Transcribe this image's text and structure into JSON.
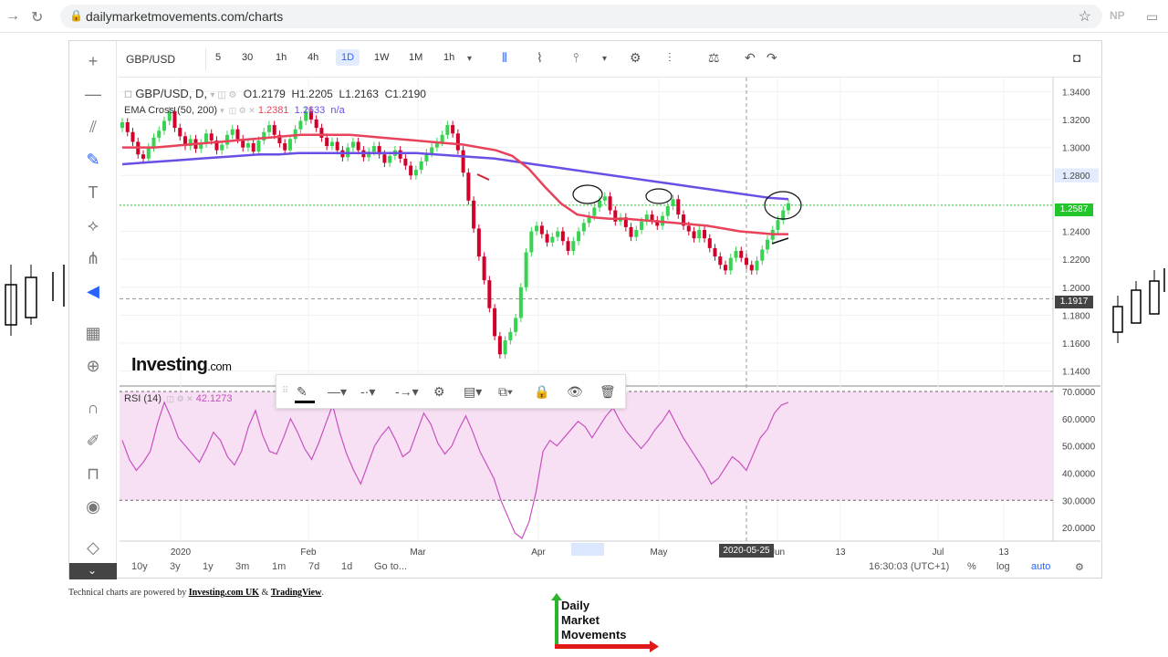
{
  "browser": {
    "url": "dailymarketmovements.com/charts",
    "profile": "NP"
  },
  "toolbar": {
    "symbol": "GBP/USD",
    "intervals": [
      "5",
      "30",
      "1h",
      "4h",
      "1D",
      "1W",
      "1M",
      "1h"
    ],
    "active_interval": "1D"
  },
  "legend": {
    "symbol_line": "GBP/USD, D,",
    "open": "O1.2179",
    "high": "H1.2205",
    "low": "L1.2163",
    "close": "C1.2190",
    "indicator_name": "EMA Cross (50, 200)",
    "ema50": "1.2381",
    "ema200": "1.2633",
    "na": "n/a",
    "rsi_name": "RSI (14)",
    "rsi_value": "42.1273"
  },
  "watermark": {
    "brand": "Investing",
    "suffix": ".com"
  },
  "price_labels": {
    "current": "1.2587",
    "crosshair": "1.1917"
  },
  "bottom_bar": {
    "ranges": [
      "10y",
      "3y",
      "1y",
      "3m",
      "1m",
      "7d",
      "1d"
    ],
    "goto": "Go to...",
    "time": "16:30:03 (UTC+1)",
    "pct": "%",
    "log": "log",
    "auto": "auto",
    "crosshair_date": "2020-05-25"
  },
  "footer": {
    "prefix": "Technical charts are powered by",
    "link1": "Investing.com UK",
    "amp": "&",
    "link2": "TradingView",
    "suffix": "."
  },
  "logo": {
    "line1": "Daily",
    "line2": "Market",
    "line3": "Movements"
  },
  "colors": {
    "bull": "#26a69a",
    "bear": "#ef5350",
    "ema50": "#e8435a",
    "ema200": "#6b4ee6",
    "rsi": "#c850c0",
    "accent": "#2962ff",
    "price_tag": "#22c52a"
  },
  "chart_data": {
    "type": "candlestick",
    "x_tick_labels": [
      "2020",
      "Feb",
      "Mar",
      "Apr",
      "May",
      "Jun",
      "13",
      "Jul",
      "13"
    ],
    "y_tick_labels": [
      "1.3400",
      "1.3200",
      "1.3000",
      "1.2800",
      "1.2400",
      "1.2200",
      "1.2000",
      "1.1800",
      "1.1600",
      "1.1400"
    ],
    "ylim": [
      1.13,
      1.35
    ],
    "rsi_tick_labels": [
      "70.0000",
      "60.0000",
      "50.0000",
      "40.0000",
      "30.0000",
      "20.0000"
    ],
    "rsi_ylim": [
      15,
      72
    ],
    "rsi_levels": [
      70,
      30
    ],
    "close": [
      1.318,
      1.311,
      1.304,
      1.295,
      1.292,
      1.3,
      1.307,
      1.312,
      1.319,
      1.326,
      1.314,
      1.308,
      1.301,
      1.306,
      1.299,
      1.303,
      1.31,
      1.305,
      1.298,
      1.302,
      1.309,
      1.313,
      1.306,
      1.3,
      1.303,
      1.297,
      1.305,
      1.311,
      1.316,
      1.309,
      1.303,
      1.298,
      1.306,
      1.313,
      1.319,
      1.326,
      1.32,
      1.314,
      1.307,
      1.301,
      1.304,
      1.298,
      1.293,
      1.3,
      1.304,
      1.298,
      1.293,
      1.297,
      1.301,
      1.295,
      1.289,
      1.294,
      1.298,
      1.292,
      1.287,
      1.28,
      1.284,
      1.29,
      1.296,
      1.3,
      1.304,
      1.309,
      1.316,
      1.31,
      1.298,
      1.282,
      1.262,
      1.242,
      1.222,
      1.205,
      1.185,
      1.165,
      1.152,
      1.162,
      1.168,
      1.178,
      1.2,
      1.225,
      1.24,
      1.244,
      1.238,
      1.232,
      1.236,
      1.24,
      1.233,
      1.226,
      1.233,
      1.24,
      1.246,
      1.251,
      1.257,
      1.262,
      1.265,
      1.255,
      1.247,
      1.25,
      1.243,
      1.236,
      1.241,
      1.247,
      1.252,
      1.248,
      1.244,
      1.251,
      1.258,
      1.263,
      1.252,
      1.244,
      1.24,
      1.235,
      1.241,
      1.235,
      1.228,
      1.222,
      1.216,
      1.212,
      1.221,
      1.226,
      1.221,
      1.216,
      1.212,
      1.219,
      1.227,
      1.234,
      1.241,
      1.248,
      1.255,
      1.26
    ],
    "ema50": [
      1.3,
      1.3,
      1.3,
      1.301,
      1.302,
      1.303,
      1.304,
      1.305,
      1.306,
      1.307,
      1.308,
      1.309,
      1.309,
      1.309,
      1.309,
      1.308,
      1.307,
      1.306,
      1.305,
      1.304,
      1.303,
      1.302,
      1.3,
      1.298,
      1.294,
      1.285,
      1.272,
      1.26,
      1.252,
      1.25,
      1.249,
      1.249,
      1.248,
      1.247,
      1.246,
      1.245,
      1.244,
      1.242,
      1.24,
      1.239,
      1.238,
      1.238
    ],
    "ema200": [
      1.288,
      1.289,
      1.29,
      1.291,
      1.292,
      1.293,
      1.294,
      1.295,
      1.295,
      1.296,
      1.296,
      1.296,
      1.296,
      1.296,
      1.296,
      1.296,
      1.295,
      1.294,
      1.293,
      1.292,
      1.29,
      1.288,
      1.286,
      1.284,
      1.282,
      1.28,
      1.278,
      1.276,
      1.274,
      1.272,
      1.27,
      1.268,
      1.266,
      1.264,
      1.263
    ],
    "rsi": [
      52,
      45,
      41,
      44,
      48,
      58,
      66,
      60,
      53,
      50,
      47,
      44,
      49,
      55,
      52,
      46,
      43,
      48,
      57,
      63,
      54,
      48,
      47,
      53,
      60,
      55,
      49,
      45,
      51,
      58,
      65,
      55,
      47,
      41,
      36,
      43,
      50,
      54,
      57,
      52,
      46,
      48,
      55,
      62,
      58,
      51,
      47,
      50,
      56,
      61,
      55,
      48,
      43,
      38,
      30,
      24,
      18,
      16,
      22,
      33,
      48,
      52,
      50,
      53,
      56,
      59,
      57,
      53,
      57,
      61,
      64,
      59,
      55,
      52,
      49,
      52,
      56,
      59,
      63,
      58,
      53,
      49,
      45,
      41,
      36,
      38,
      42,
      46,
      44,
      41,
      47,
      53,
      56,
      62,
      65,
      66
    ]
  }
}
